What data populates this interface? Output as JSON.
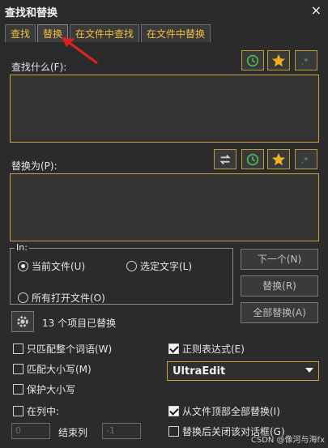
{
  "window": {
    "title": "查找和替换",
    "close_glyph": "×"
  },
  "tabs": [
    {
      "label": "查找"
    },
    {
      "label": "替换"
    },
    {
      "label": "在文件中查找"
    },
    {
      "label": "在文件中替换"
    }
  ],
  "find": {
    "label": "查找什么(F):"
  },
  "replace": {
    "label": "替换为(P):"
  },
  "icons": {
    "history": "history-icon",
    "favorite": "star-icon",
    "regex": "regex-icon",
    "swap": "swap-icon",
    "settings": "gear-icon"
  },
  "scope": {
    "label": "In:",
    "current_file": "当前文件(U)",
    "selected_text": "选定文字(L)",
    "all_open_files": "所有打开文件(O)"
  },
  "buttons": {
    "next": "下一个(N)",
    "replace": "替换(R)",
    "replace_all": "全部替换(A)"
  },
  "status": "13 个项目已替换",
  "options": {
    "match_whole_word": "只匹配整个词语(W)",
    "match_case": "匹配大小写(M)",
    "preserve_case": "保护大小写",
    "in_column": "在列中:",
    "regex": "正则表达式(E)",
    "regex_engine": "UltraEdit",
    "replace_all_from_top": "从文件顶部全部替换(I)",
    "close_after_replace": "替换后关闭该对话框(G)"
  },
  "columns": {
    "start_value": "0",
    "end_label": "结束列",
    "end_value": "-1"
  },
  "footer": "CSDN @像河与海fx",
  "colors": {
    "accent": "#c9a43a",
    "tab_text": "#f0c040",
    "annotation": "#e02020"
  }
}
